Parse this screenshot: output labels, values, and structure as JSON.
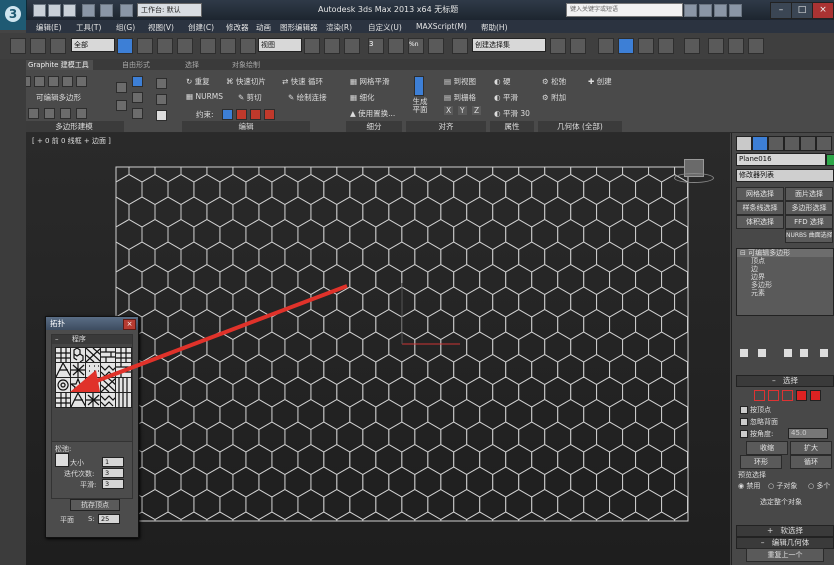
{
  "titlebar": {
    "app_title": "Autodesk 3ds Max 2013 x64   无标题",
    "workspace": "工作台: 默认",
    "search_placeholder": "键入关键字或短语",
    "logo_letter": "3"
  },
  "menubar": [
    "编辑(E)",
    "工具(T)",
    "组(G)",
    "视图(V)",
    "创建(C)",
    "修改器",
    "动画",
    "图形编辑器",
    "渲染(R)",
    "自定义(U)",
    "MAXScript(M)",
    "帮助(H)"
  ],
  "toolbar": {
    "selection_filter": "全部",
    "ref_coord": "视图",
    "named_selection": "创建选择集",
    "snap_labels": [
      "3",
      "%n"
    ]
  },
  "ribbon": {
    "tabs": [
      "Graphite 建模工具",
      "自由形式",
      "选择",
      "对象绘制"
    ],
    "left_panel_label": "可编辑多边形",
    "footer_left": "多边形建模",
    "footer_edit": "编辑",
    "footer_geometry_all": "几何体 (全部)",
    "footer_subdivision": "细分",
    "footer_align": "对齐",
    "footer_properties": "属性",
    "edit": {
      "repeat": "重复",
      "quickslice": "快速切片",
      "swiftloop": "快速 循环",
      "qslice_extra": "",
      "nurms": "NURMS",
      "cut": "剪切",
      "paint_connect": "绘制连接",
      "constraints": "约束:"
    },
    "subdiv": {
      "meshsmooth": "网格平滑",
      "tessellate": "细化",
      "use_displacement": "使用置换..."
    },
    "align": {
      "make_planar": "生成平面",
      "to_view": "到视图",
      "to_grid": "到栅格",
      "xyz": [
        "X",
        "Y",
        "Z"
      ]
    },
    "props": {
      "hard": "硬",
      "smooth": "平滑",
      "smooth30": "平滑 30"
    },
    "geom": {
      "relax": "松弛",
      "create": "创建",
      "attach": "附加"
    }
  },
  "viewport": {
    "label": "[ + 0 前 0 线框 + 边面 ]"
  },
  "command_panel": {
    "object_name": "Plane016",
    "modifier_list": "修改器列表",
    "buttons": [
      "网格选择",
      "面片选择",
      "样条线选择",
      "多边形选择",
      "体积选择",
      "FFD 选择",
      "NURBS 曲面选择"
    ],
    "stack": [
      "可编辑多边形",
      "顶点",
      "边",
      "边界",
      "多边形",
      "元素"
    ],
    "selection_rollout": "选择",
    "by_vertex": "按顶点",
    "ignore_backfacing": "忽略背面",
    "by_angle": "按角度:",
    "angle_value": "45.0",
    "shrink": "收缩",
    "grow": "扩大",
    "ring": "环形",
    "loop": "循环",
    "preview_selection": "预览选择",
    "disabled": "禁用",
    "subobject": "子对象",
    "multi": "多个",
    "selected_whole": "选定整个对象",
    "soft_selection": "软选择",
    "edit_geometry": "编辑几何体",
    "repeat_last": "重复上一个"
  },
  "topology_dialog": {
    "title": "拓扑",
    "procedures": "程序",
    "relax_group": "松弛:",
    "amount": "大小",
    "amount_value": "1",
    "iterations": "迭代次数:",
    "iterations_value": "3",
    "smoothness": "平滑:",
    "smoothness_value": "3",
    "store_vertices": "抗存顶点",
    "plane": "平面",
    "s_label": "S:",
    "s_value": "25"
  },
  "colors": {
    "arrow": "#e0322a",
    "grid_line": "#cfcfcf",
    "active_button": "#3d7fd6"
  }
}
